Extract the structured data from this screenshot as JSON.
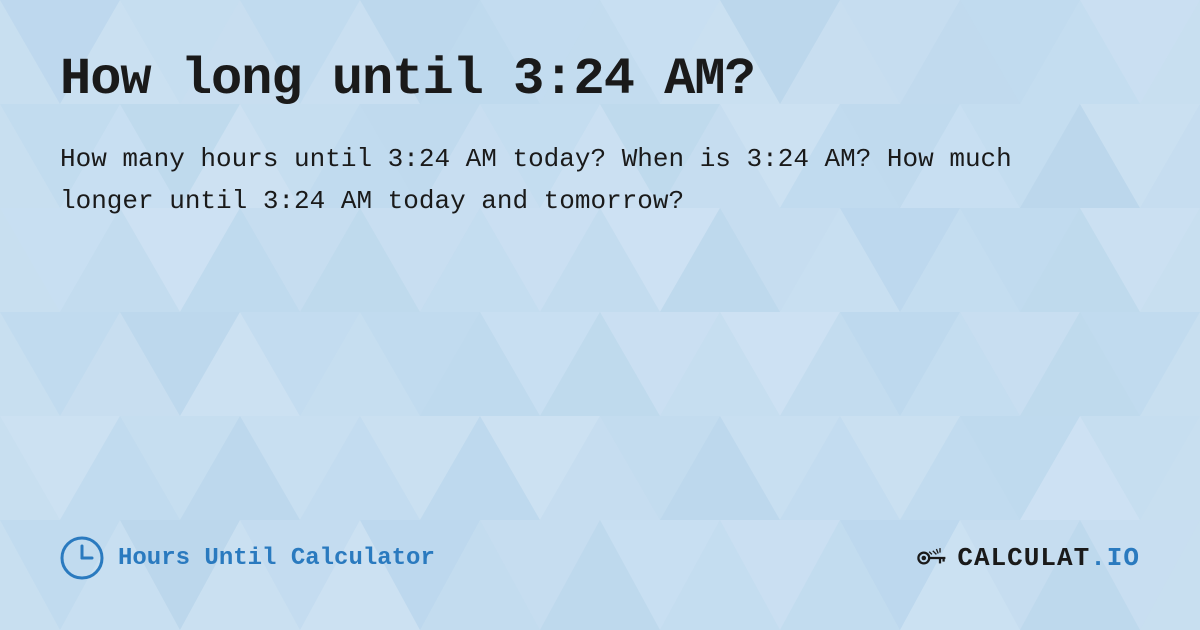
{
  "page": {
    "title": "How long until 3:24 AM?",
    "description": "How many hours until 3:24 AM today? When is 3:24 AM? How much longer until 3:24 AM today and tomorrow?",
    "footer": {
      "brand_label": "Hours Until Calculator",
      "site_name": "CALCULAT.IO",
      "site_name_accent": ".IO"
    }
  },
  "colors": {
    "background": "#c8dff0",
    "text_dark": "#1a1a1a",
    "accent_blue": "#2a7abf"
  }
}
